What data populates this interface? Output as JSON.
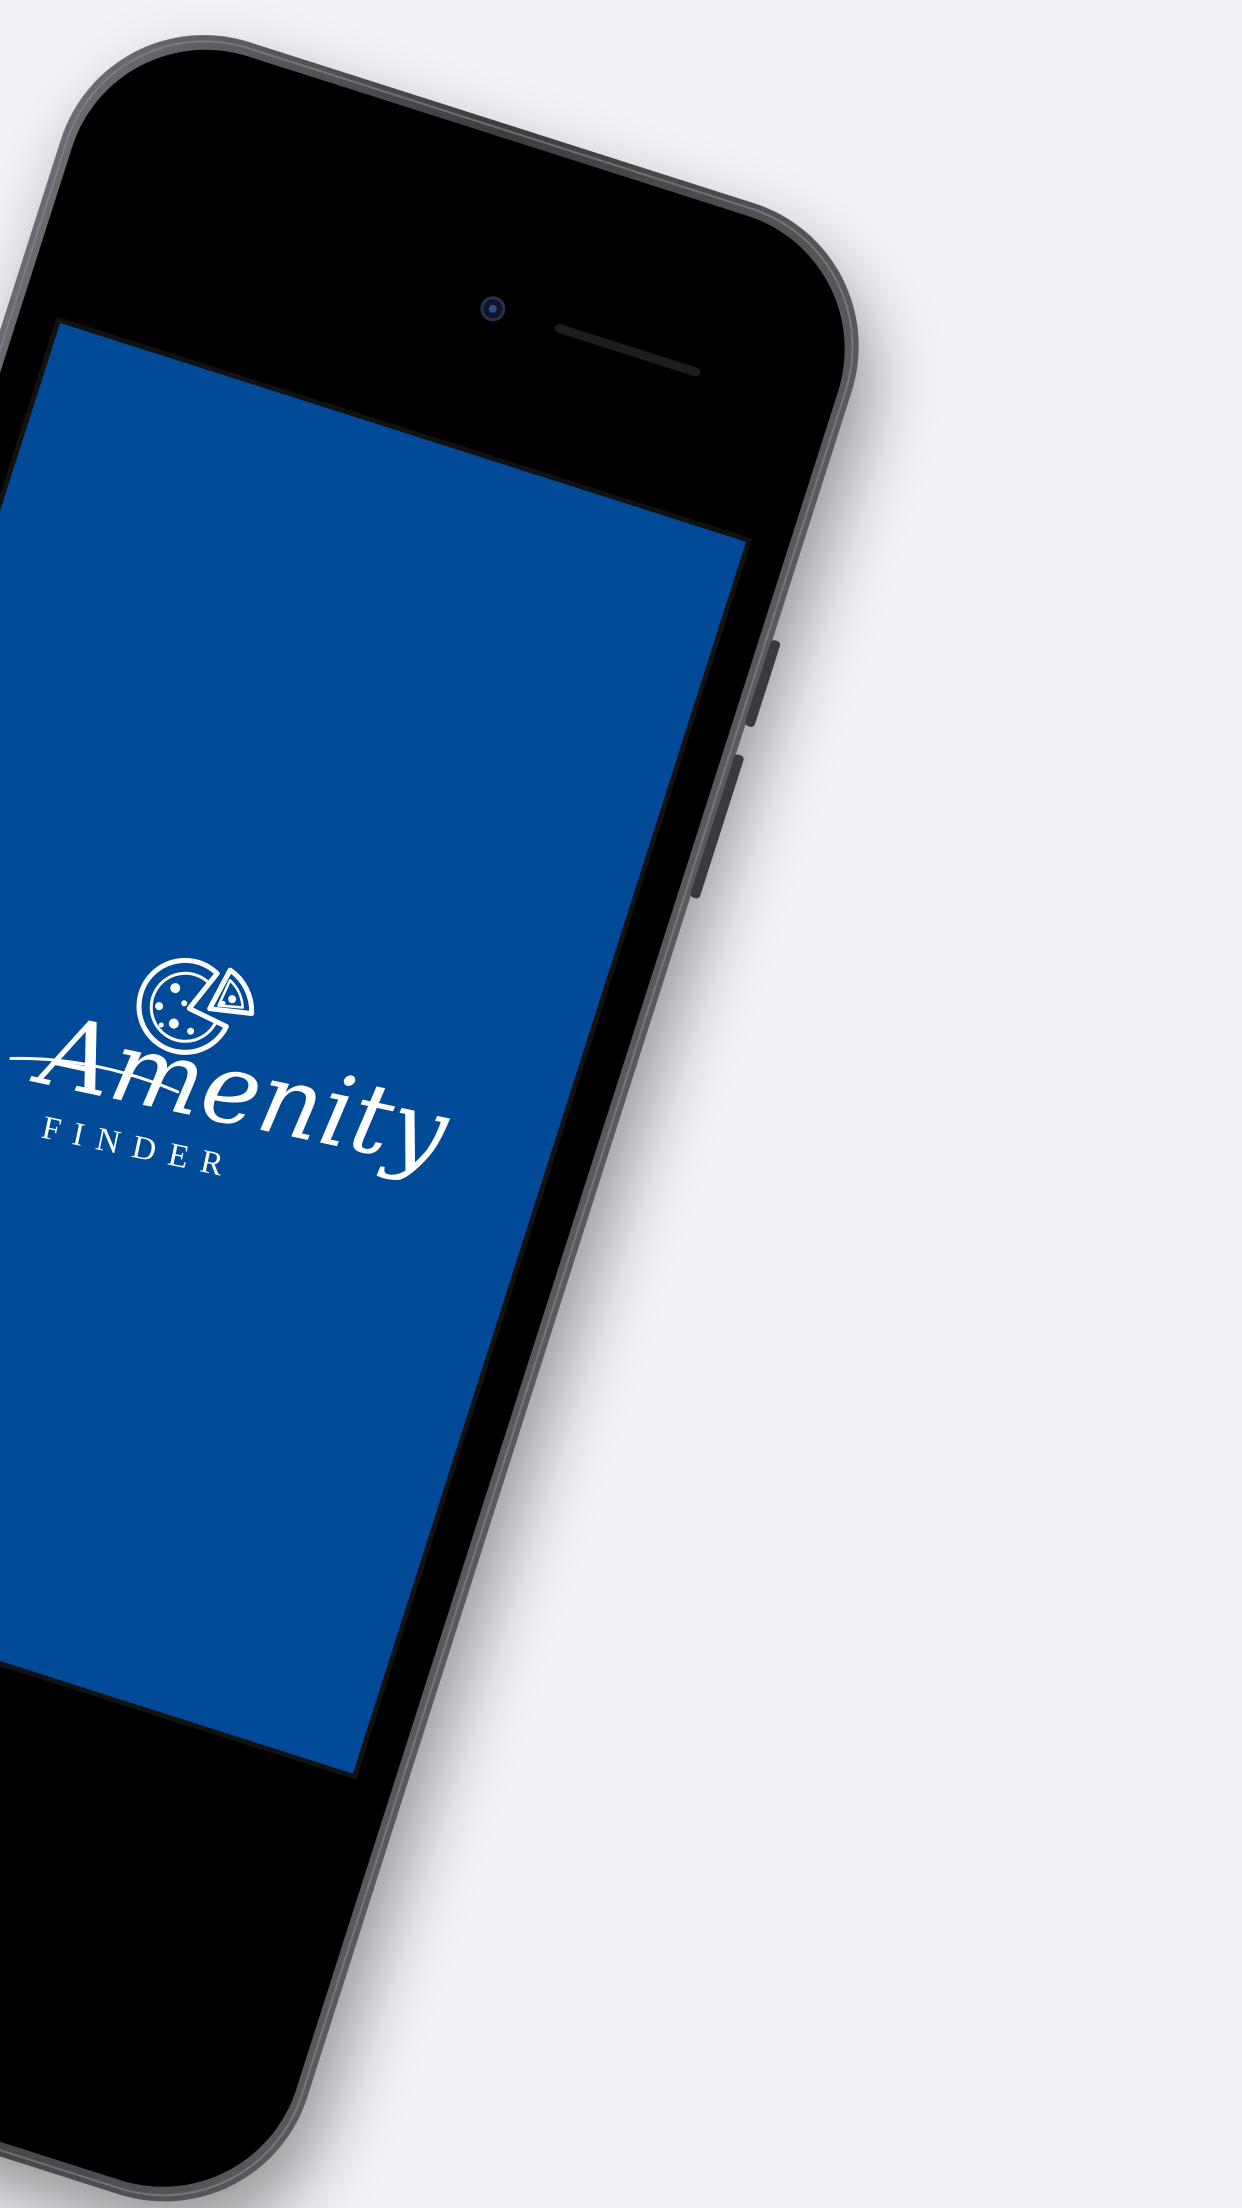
{
  "app": {
    "brand_name": "Amenity",
    "brand_subtitle": "FINDER",
    "logo_icon": "pizza-icon"
  },
  "colors": {
    "background": "#f2f2f7",
    "screen": "#004a97",
    "device_frame": "#4a4a4e",
    "device_body": "#000000",
    "logo": "#ffffff"
  }
}
